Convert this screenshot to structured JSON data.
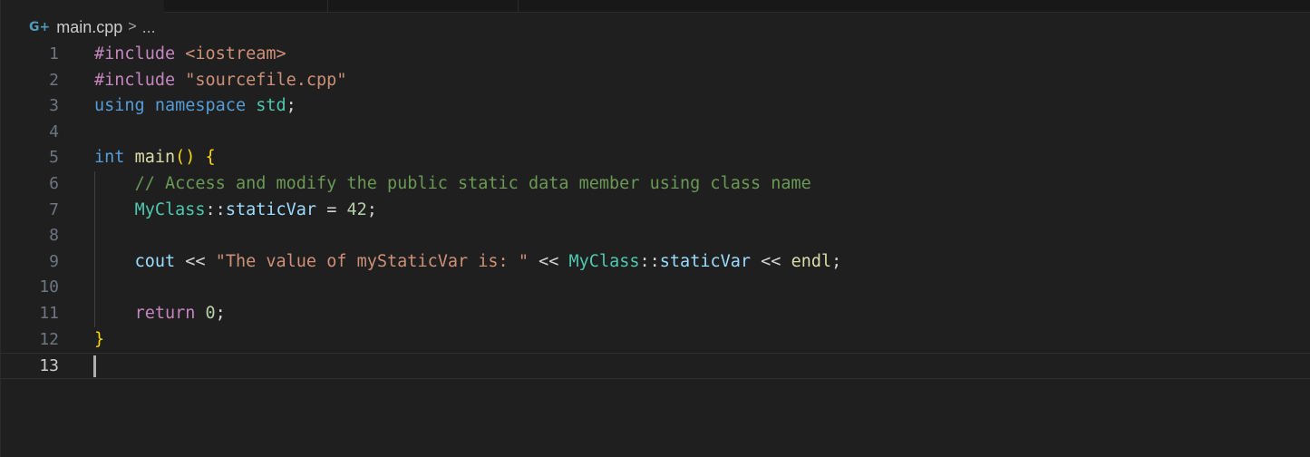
{
  "breadcrumb": {
    "file": "main.cpp",
    "separator": ">",
    "ellipsis": "..."
  },
  "icons": {
    "file_icon": "cpp-file-icon",
    "file_icon_glyph": "G+"
  },
  "colors": {
    "background": "#1f1f1f",
    "keyword": "#569cd6",
    "preprocessor": "#c586c0",
    "string": "#ce9178",
    "comment": "#6a9955",
    "type": "#4ec9b0",
    "variable": "#9cdcfe",
    "number": "#b5cea8",
    "function": "#dcdcaa",
    "bracket": "#ffd700"
  },
  "editor": {
    "current_line": 13,
    "lines": [
      {
        "n": "1",
        "tokens": [
          [
            "kw-pre",
            "#include"
          ],
          [
            "plain",
            " "
          ],
          [
            "str",
            "<iostream>"
          ]
        ]
      },
      {
        "n": "2",
        "tokens": [
          [
            "kw-pre",
            "#include"
          ],
          [
            "plain",
            " "
          ],
          [
            "str",
            "\"sourcefile.cpp\""
          ]
        ]
      },
      {
        "n": "3",
        "tokens": [
          [
            "kw",
            "using"
          ],
          [
            "plain",
            " "
          ],
          [
            "kw",
            "namespace"
          ],
          [
            "plain",
            " "
          ],
          [
            "ns",
            "std"
          ],
          [
            "plain",
            ";"
          ]
        ]
      },
      {
        "n": "4",
        "tokens": []
      },
      {
        "n": "5",
        "tokens": [
          [
            "kw",
            "int"
          ],
          [
            "plain",
            " "
          ],
          [
            "fn",
            "main"
          ],
          [
            "brace",
            "()"
          ],
          [
            "plain",
            " "
          ],
          [
            "brace",
            "{"
          ]
        ]
      },
      {
        "n": "6",
        "tokens": [
          [
            "plain",
            "    "
          ],
          [
            "cmt",
            "// Access and modify the public static data member using class name"
          ]
        ]
      },
      {
        "n": "7",
        "tokens": [
          [
            "plain",
            "    "
          ],
          [
            "cls",
            "MyClass"
          ],
          [
            "plain",
            "::"
          ],
          [
            "var",
            "staticVar"
          ],
          [
            "plain",
            " = "
          ],
          [
            "num",
            "42"
          ],
          [
            "plain",
            ";"
          ]
        ]
      },
      {
        "n": "8",
        "tokens": []
      },
      {
        "n": "9",
        "tokens": [
          [
            "plain",
            "    "
          ],
          [
            "var",
            "cout"
          ],
          [
            "plain",
            " << "
          ],
          [
            "str",
            "\"The value of myStaticVar is: \""
          ],
          [
            "plain",
            " << "
          ],
          [
            "cls",
            "MyClass"
          ],
          [
            "plain",
            "::"
          ],
          [
            "var",
            "staticVar"
          ],
          [
            "plain",
            " << "
          ],
          [
            "fn",
            "endl"
          ],
          [
            "plain",
            ";"
          ]
        ]
      },
      {
        "n": "10",
        "tokens": []
      },
      {
        "n": "11",
        "tokens": [
          [
            "plain",
            "    "
          ],
          [
            "ctrl",
            "return"
          ],
          [
            "plain",
            " "
          ],
          [
            "num",
            "0"
          ],
          [
            "plain",
            ";"
          ]
        ]
      },
      {
        "n": "12",
        "tokens": [
          [
            "brace",
            "}"
          ]
        ]
      },
      {
        "n": "13",
        "tokens": []
      }
    ]
  }
}
